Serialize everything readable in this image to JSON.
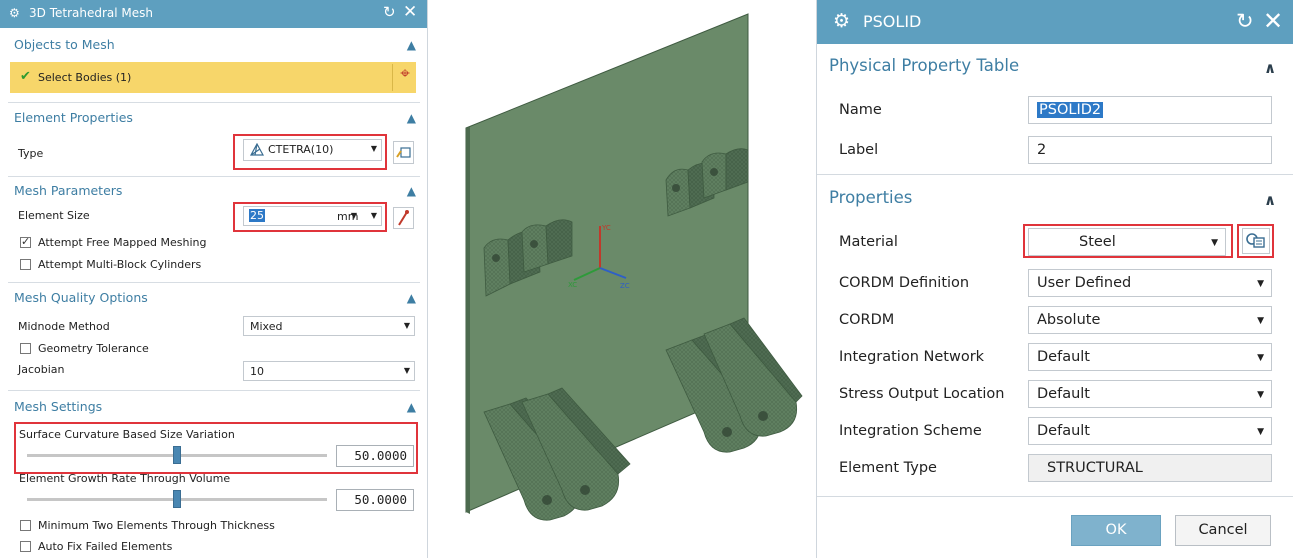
{
  "left_dialog": {
    "title": "3D Tetrahedral Mesh",
    "objects_section": {
      "title": "Objects to Mesh",
      "select_label": "Select Bodies (1)"
    },
    "element_properties": {
      "title": "Element Properties",
      "type_label": "Type",
      "type_value": "CTETRA(10)"
    },
    "mesh_parameters": {
      "title": "Mesh Parameters",
      "element_size_label": "Element Size",
      "element_size_value": "25",
      "unit": "mm",
      "attempt_free_mapped": "Attempt Free Mapped Meshing",
      "attempt_multi_block": "Attempt Multi-Block Cylinders",
      "attempt_free_mapped_checked": true,
      "attempt_multi_block_checked": false
    },
    "mesh_quality": {
      "title": "Mesh Quality Options",
      "midnode_label": "Midnode Method",
      "midnode_value": "Mixed",
      "geometry_tolerance": "Geometry Tolerance",
      "jacobian_label": "Jacobian",
      "jacobian_value": "10"
    },
    "mesh_settings": {
      "title": "Mesh Settings",
      "surface_curvature_label": "Surface Curvature Based Size Variation",
      "surface_curvature_value": "50.0000",
      "surface_curvature_fraction": 0.5,
      "growth_rate_label": "Element Growth Rate Through Volume",
      "growth_rate_value": "50.0000",
      "growth_rate_fraction": 0.5,
      "min_two_elements": "Minimum Two Elements Through Thickness",
      "auto_fix": "Auto Fix Failed Elements"
    }
  },
  "viewport": {
    "axis_labels": {
      "y": "YC",
      "x": "XC",
      "z": "ZC"
    },
    "mesh_color": "#5d7d5d"
  },
  "right_dialog": {
    "title": "PSOLID",
    "physical_property_table": {
      "title": "Physical Property Table",
      "name_label": "Name",
      "name_value": "PSOLID2",
      "label_label": "Label",
      "label_value": "2"
    },
    "properties": {
      "title": "Properties",
      "material_label": "Material",
      "material_value": "Steel",
      "rows": [
        {
          "label": "CORDM Definition",
          "value": "User Defined"
        },
        {
          "label": "CORDM",
          "value": "Absolute"
        },
        {
          "label": "Integration Network",
          "value": "Default"
        },
        {
          "label": "Stress Output Location",
          "value": "Default"
        },
        {
          "label": "Integration Scheme",
          "value": "Default"
        }
      ],
      "element_type_label": "Element Type",
      "element_type_value": "STRUCTURAL"
    },
    "ok_label": "OK",
    "cancel_label": "Cancel"
  },
  "colors": {
    "titlebar": "#5e9fbf",
    "section_header": "#3e7ea3",
    "selection_bar": "#f7d66a",
    "highlight_box": "#e0343b"
  }
}
